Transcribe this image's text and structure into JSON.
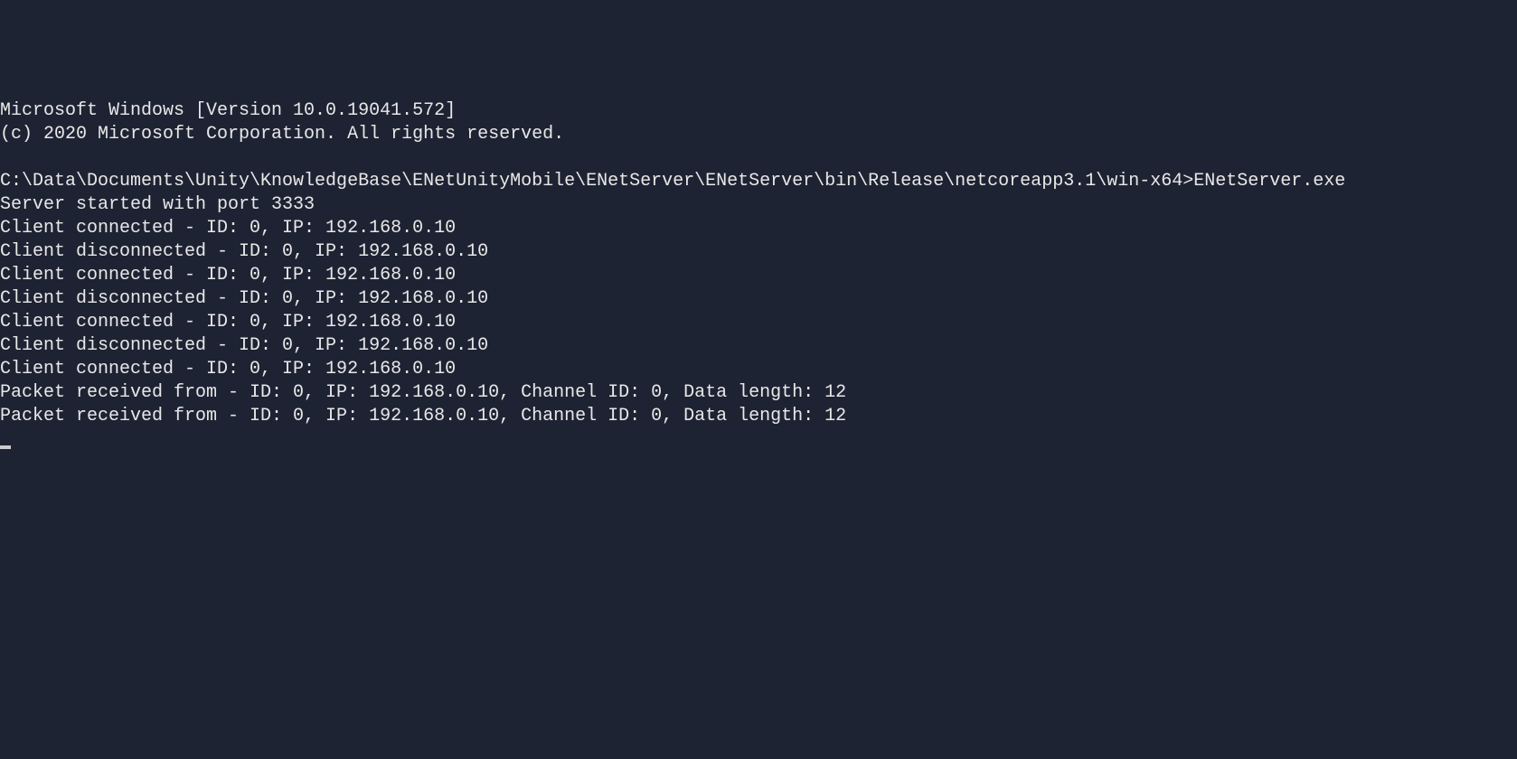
{
  "terminal": {
    "lines": [
      "Microsoft Windows [Version 10.0.19041.572]",
      "(c) 2020 Microsoft Corporation. All rights reserved.",
      "",
      "C:\\Data\\Documents\\Unity\\KnowledgeBase\\ENetUnityMobile\\ENetServer\\ENetServer\\bin\\Release\\netcoreapp3.1\\win-x64>ENetServer.exe",
      "Server started with port 3333",
      "Client connected - ID: 0, IP: 192.168.0.10",
      "Client disconnected - ID: 0, IP: 192.168.0.10",
      "Client connected - ID: 0, IP: 192.168.0.10",
      "Client disconnected - ID: 0, IP: 192.168.0.10",
      "Client connected - ID: 0, IP: 192.168.0.10",
      "Client disconnected - ID: 0, IP: 192.168.0.10",
      "Client connected - ID: 0, IP: 192.168.0.10",
      "Packet received from - ID: 0, IP: 192.168.0.10, Channel ID: 0, Data length: 12",
      "Packet received from - ID: 0, IP: 192.168.0.10, Channel ID: 0, Data length: 12"
    ]
  }
}
